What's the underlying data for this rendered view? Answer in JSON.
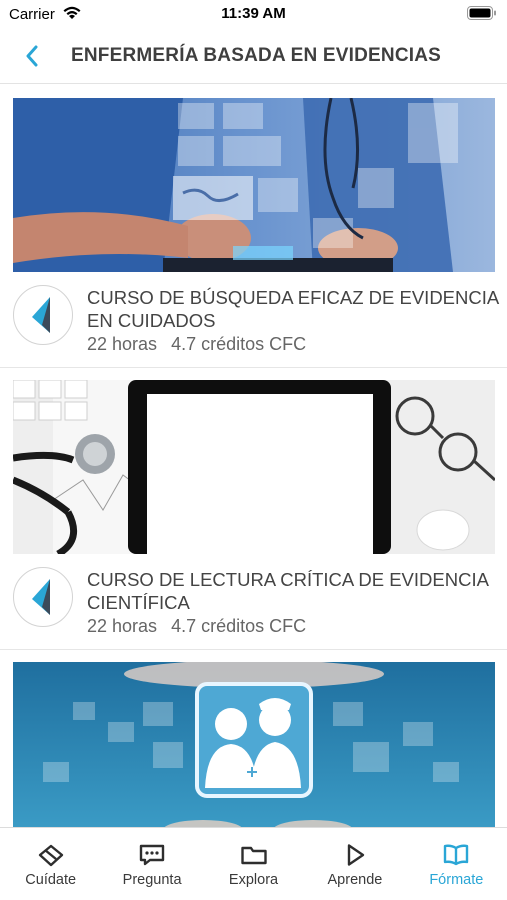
{
  "status": {
    "carrier": "Carrier",
    "time": "11:39 AM"
  },
  "nav": {
    "title": "ENFERMERÍA BASADA EN EVIDENCIAS"
  },
  "courses": [
    {
      "title": "CURSO DE BÚSQUEDA EFICAZ DE EVIDENCIA EN CUIDADOS",
      "hours": "22 horas",
      "credits": "4.7 créditos CFC"
    },
    {
      "title": "CURSO DE LECTURA CRÍTICA DE EVIDENCIA CIENTÍFICA",
      "hours": "22 horas",
      "credits": "4.7 créditos CFC"
    }
  ],
  "tabs": [
    {
      "label": "Cuídate",
      "icon": "heart-diamond-icon"
    },
    {
      "label": "Pregunta",
      "icon": "chat-bubble-icon"
    },
    {
      "label": "Explora",
      "icon": "folder-icon"
    },
    {
      "label": "Aprende",
      "icon": "play-icon"
    },
    {
      "label": "Fórmate",
      "icon": "open-book-icon",
      "active": true
    }
  ],
  "colors": {
    "accent": "#2aa6d6",
    "text": "#3f3f3f"
  }
}
